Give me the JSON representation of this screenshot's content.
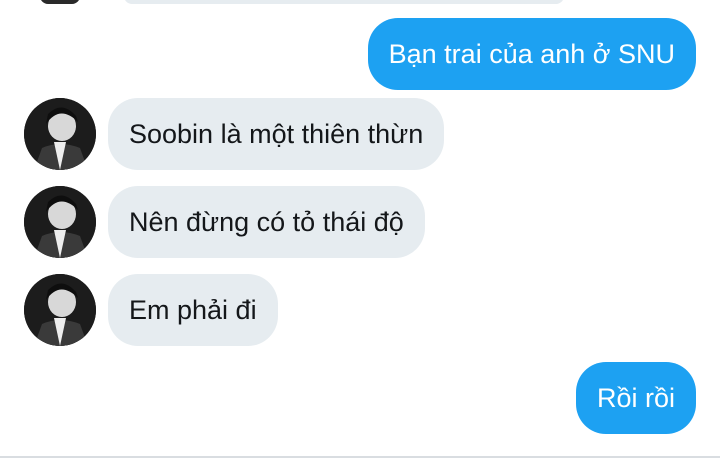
{
  "messages": [
    {
      "direction": "outgoing",
      "text": "Bạn trai của anh ở SNU"
    },
    {
      "direction": "incoming",
      "text": "Soobin là một thiên thừn"
    },
    {
      "direction": "incoming",
      "text": "Nên đừng có tỏ thái độ"
    },
    {
      "direction": "incoming",
      "text": "Em phải đi"
    },
    {
      "direction": "outgoing",
      "text": "Rồi rồi"
    }
  ],
  "avatar_icon": "profile-photo-icon",
  "colors": {
    "outgoing_bubble": "#1da1f2",
    "incoming_bubble": "#e6ecf0",
    "incoming_text": "#14171a",
    "background": "#ffffff"
  }
}
